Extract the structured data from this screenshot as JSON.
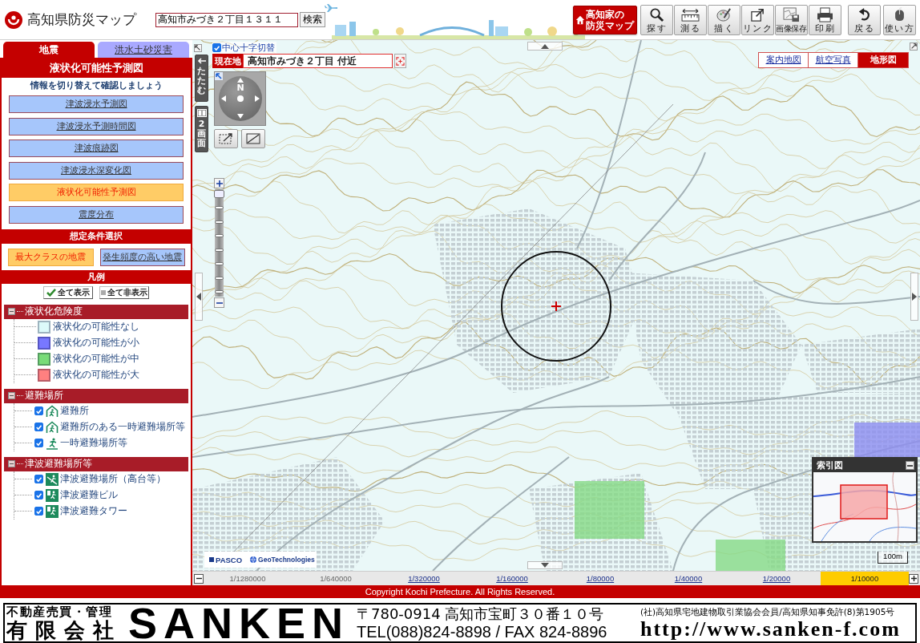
{
  "header": {
    "title": "高知県防災マップ",
    "search": {
      "value": "高知市みづき２丁目１３１１"
    },
    "search_button": "検索",
    "promo_button": {
      "lines": [
        "高知家の",
        "防災マップ"
      ]
    },
    "tools": [
      {
        "label": "探す"
      },
      {
        "label": "測る"
      },
      {
        "label": "描く"
      },
      {
        "label": "リンク"
      },
      {
        "label": "画像保存"
      },
      {
        "label": "印刷"
      }
    ],
    "nav_tools": [
      {
        "label": "戻る"
      },
      {
        "label": "使い方"
      }
    ]
  },
  "sidebar": {
    "tabs": [
      {
        "label": "地震",
        "selected": true
      },
      {
        "label": "洪水土砂災害",
        "selected": false
      }
    ],
    "heading": "液状化可能性予測図",
    "hint": "情報を切り替えて確認しましょう",
    "maps": [
      {
        "label": "津波浸水予測図",
        "selected": false
      },
      {
        "label": "津波浸水予測時間図",
        "selected": false
      },
      {
        "label": "津波痕跡図",
        "selected": false
      },
      {
        "label": "津波浸水深変化図",
        "selected": false
      },
      {
        "label": "液状化可能性予測図",
        "selected": true
      },
      {
        "label": "震度分布",
        "selected": false
      }
    ],
    "conditions_heading": "想定条件選択",
    "conditions": [
      {
        "label": "最大クラスの地震",
        "selected": true
      },
      {
        "label": "発生頻度の高い地震",
        "selected": false
      }
    ],
    "legend_heading": "凡例",
    "show_all": "全て表示",
    "hide_all": "全て非表示",
    "legend_groups": [
      {
        "label": "液状化危険度",
        "expanded": true,
        "children": [
          {
            "kind": "swatch",
            "label": "液状化の可能性なし",
            "color": "#dcfafa"
          },
          {
            "kind": "swatch",
            "label": "液状化の可能性が小",
            "color": "#7878ff"
          },
          {
            "kind": "swatch",
            "label": "液状化の可能性が中",
            "color": "#78dc78"
          },
          {
            "kind": "swatch",
            "label": "液状化の可能性が大",
            "color": "#ff8080"
          }
        ]
      },
      {
        "label": "避難場所",
        "expanded": true,
        "children": [
          {
            "kind": "checkbox",
            "label": "避難所",
            "checked": true
          },
          {
            "kind": "checkbox",
            "label": "避難所のある一時避難場所等",
            "checked": true
          },
          {
            "kind": "checkbox",
            "label": "一時避難場所等",
            "checked": true
          }
        ]
      },
      {
        "label": "津波避難場所等",
        "expanded": true,
        "children": [
          {
            "kind": "checkbox",
            "label": "津波避難場所（高台等）",
            "checked": true
          },
          {
            "kind": "checkbox",
            "label": "津波避難ビル",
            "checked": true
          },
          {
            "kind": "checkbox",
            "label": "津波避難タワー",
            "checked": true
          }
        ]
      }
    ]
  },
  "map": {
    "center_cross": {
      "label": "中心十字切替",
      "checked": true
    },
    "location": {
      "label": "現在地",
      "value": "高知市みづき２丁目 付近"
    },
    "side_buttons": [
      {
        "label": "たたむ"
      },
      {
        "label": "2画面"
      }
    ],
    "compass": {
      "label": "N"
    },
    "zoom": {
      "level": 1
    },
    "base_maps": [
      {
        "label": "案内地図",
        "selected": false
      },
      {
        "label": "航空写真",
        "selected": false
      },
      {
        "label": "地形図",
        "selected": true
      }
    ],
    "index_map": {
      "title": "索引図"
    },
    "attribution": [
      "PASCO",
      "GeoTechnologies"
    ],
    "scale_label": "100m"
  },
  "scales": [
    {
      "label": "1/1280000",
      "selected": false,
      "disabled": true
    },
    {
      "label": "1/640000",
      "selected": false,
      "disabled": true
    },
    {
      "label": "1/320000",
      "selected": false,
      "disabled": false
    },
    {
      "label": "1/160000",
      "selected": false,
      "disabled": false
    },
    {
      "label": "1/80000",
      "selected": false,
      "disabled": false
    },
    {
      "label": "1/40000",
      "selected": false,
      "disabled": false
    },
    {
      "label": "1/20000",
      "selected": false,
      "disabled": false
    },
    {
      "label": "1/10000",
      "selected": true,
      "disabled": false
    }
  ],
  "copyright": "Copyright Kochi Prefecture. All Rights Reserved.",
  "banner": {
    "tagline": "不動産売買・管理",
    "company_type": "有限会社",
    "brand": "SANKEN",
    "address": "〒780-0914 高知市宝町３０番１０号",
    "phone": "TEL(088)824-8898 / FAX 824-8896",
    "license": "(社)高知県宅地建物取引業協会会員/高知県知事免許(8)第1905号",
    "url": "http://www.sanken-f.com"
  }
}
